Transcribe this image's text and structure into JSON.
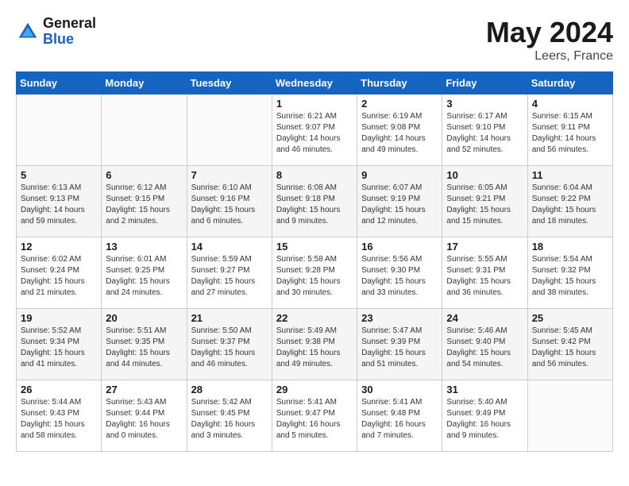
{
  "header": {
    "logo_general": "General",
    "logo_blue": "Blue",
    "month": "May 2024",
    "location": "Leers, France"
  },
  "days_of_week": [
    "Sunday",
    "Monday",
    "Tuesday",
    "Wednesday",
    "Thursday",
    "Friday",
    "Saturday"
  ],
  "weeks": [
    [
      {
        "num": "",
        "sunrise": "",
        "sunset": "",
        "daylight": ""
      },
      {
        "num": "",
        "sunrise": "",
        "sunset": "",
        "daylight": ""
      },
      {
        "num": "",
        "sunrise": "",
        "sunset": "",
        "daylight": ""
      },
      {
        "num": "1",
        "sunrise": "Sunrise: 6:21 AM",
        "sunset": "Sunset: 9:07 PM",
        "daylight": "Daylight: 14 hours and 46 minutes."
      },
      {
        "num": "2",
        "sunrise": "Sunrise: 6:19 AM",
        "sunset": "Sunset: 9:08 PM",
        "daylight": "Daylight: 14 hours and 49 minutes."
      },
      {
        "num": "3",
        "sunrise": "Sunrise: 6:17 AM",
        "sunset": "Sunset: 9:10 PM",
        "daylight": "Daylight: 14 hours and 52 minutes."
      },
      {
        "num": "4",
        "sunrise": "Sunrise: 6:15 AM",
        "sunset": "Sunset: 9:11 PM",
        "daylight": "Daylight: 14 hours and 56 minutes."
      }
    ],
    [
      {
        "num": "5",
        "sunrise": "Sunrise: 6:13 AM",
        "sunset": "Sunset: 9:13 PM",
        "daylight": "Daylight: 14 hours and 59 minutes."
      },
      {
        "num": "6",
        "sunrise": "Sunrise: 6:12 AM",
        "sunset": "Sunset: 9:15 PM",
        "daylight": "Daylight: 15 hours and 2 minutes."
      },
      {
        "num": "7",
        "sunrise": "Sunrise: 6:10 AM",
        "sunset": "Sunset: 9:16 PM",
        "daylight": "Daylight: 15 hours and 6 minutes."
      },
      {
        "num": "8",
        "sunrise": "Sunrise: 6:08 AM",
        "sunset": "Sunset: 9:18 PM",
        "daylight": "Daylight: 15 hours and 9 minutes."
      },
      {
        "num": "9",
        "sunrise": "Sunrise: 6:07 AM",
        "sunset": "Sunset: 9:19 PM",
        "daylight": "Daylight: 15 hours and 12 minutes."
      },
      {
        "num": "10",
        "sunrise": "Sunrise: 6:05 AM",
        "sunset": "Sunset: 9:21 PM",
        "daylight": "Daylight: 15 hours and 15 minutes."
      },
      {
        "num": "11",
        "sunrise": "Sunrise: 6:04 AM",
        "sunset": "Sunset: 9:22 PM",
        "daylight": "Daylight: 15 hours and 18 minutes."
      }
    ],
    [
      {
        "num": "12",
        "sunrise": "Sunrise: 6:02 AM",
        "sunset": "Sunset: 9:24 PM",
        "daylight": "Daylight: 15 hours and 21 minutes."
      },
      {
        "num": "13",
        "sunrise": "Sunrise: 6:01 AM",
        "sunset": "Sunset: 9:25 PM",
        "daylight": "Daylight: 15 hours and 24 minutes."
      },
      {
        "num": "14",
        "sunrise": "Sunrise: 5:59 AM",
        "sunset": "Sunset: 9:27 PM",
        "daylight": "Daylight: 15 hours and 27 minutes."
      },
      {
        "num": "15",
        "sunrise": "Sunrise: 5:58 AM",
        "sunset": "Sunset: 9:28 PM",
        "daylight": "Daylight: 15 hours and 30 minutes."
      },
      {
        "num": "16",
        "sunrise": "Sunrise: 5:56 AM",
        "sunset": "Sunset: 9:30 PM",
        "daylight": "Daylight: 15 hours and 33 minutes."
      },
      {
        "num": "17",
        "sunrise": "Sunrise: 5:55 AM",
        "sunset": "Sunset: 9:31 PM",
        "daylight": "Daylight: 15 hours and 36 minutes."
      },
      {
        "num": "18",
        "sunrise": "Sunrise: 5:54 AM",
        "sunset": "Sunset: 9:32 PM",
        "daylight": "Daylight: 15 hours and 38 minutes."
      }
    ],
    [
      {
        "num": "19",
        "sunrise": "Sunrise: 5:52 AM",
        "sunset": "Sunset: 9:34 PM",
        "daylight": "Daylight: 15 hours and 41 minutes."
      },
      {
        "num": "20",
        "sunrise": "Sunrise: 5:51 AM",
        "sunset": "Sunset: 9:35 PM",
        "daylight": "Daylight: 15 hours and 44 minutes."
      },
      {
        "num": "21",
        "sunrise": "Sunrise: 5:50 AM",
        "sunset": "Sunset: 9:37 PM",
        "daylight": "Daylight: 15 hours and 46 minutes."
      },
      {
        "num": "22",
        "sunrise": "Sunrise: 5:49 AM",
        "sunset": "Sunset: 9:38 PM",
        "daylight": "Daylight: 15 hours and 49 minutes."
      },
      {
        "num": "23",
        "sunrise": "Sunrise: 5:47 AM",
        "sunset": "Sunset: 9:39 PM",
        "daylight": "Daylight: 15 hours and 51 minutes."
      },
      {
        "num": "24",
        "sunrise": "Sunrise: 5:46 AM",
        "sunset": "Sunset: 9:40 PM",
        "daylight": "Daylight: 15 hours and 54 minutes."
      },
      {
        "num": "25",
        "sunrise": "Sunrise: 5:45 AM",
        "sunset": "Sunset: 9:42 PM",
        "daylight": "Daylight: 15 hours and 56 minutes."
      }
    ],
    [
      {
        "num": "26",
        "sunrise": "Sunrise: 5:44 AM",
        "sunset": "Sunset: 9:43 PM",
        "daylight": "Daylight: 15 hours and 58 minutes."
      },
      {
        "num": "27",
        "sunrise": "Sunrise: 5:43 AM",
        "sunset": "Sunset: 9:44 PM",
        "daylight": "Daylight: 16 hours and 0 minutes."
      },
      {
        "num": "28",
        "sunrise": "Sunrise: 5:42 AM",
        "sunset": "Sunset: 9:45 PM",
        "daylight": "Daylight: 16 hours and 3 minutes."
      },
      {
        "num": "29",
        "sunrise": "Sunrise: 5:41 AM",
        "sunset": "Sunset: 9:47 PM",
        "daylight": "Daylight: 16 hours and 5 minutes."
      },
      {
        "num": "30",
        "sunrise": "Sunrise: 5:41 AM",
        "sunset": "Sunset: 9:48 PM",
        "daylight": "Daylight: 16 hours and 7 minutes."
      },
      {
        "num": "31",
        "sunrise": "Sunrise: 5:40 AM",
        "sunset": "Sunset: 9:49 PM",
        "daylight": "Daylight: 16 hours and 9 minutes."
      },
      {
        "num": "",
        "sunrise": "",
        "sunset": "",
        "daylight": ""
      }
    ]
  ]
}
